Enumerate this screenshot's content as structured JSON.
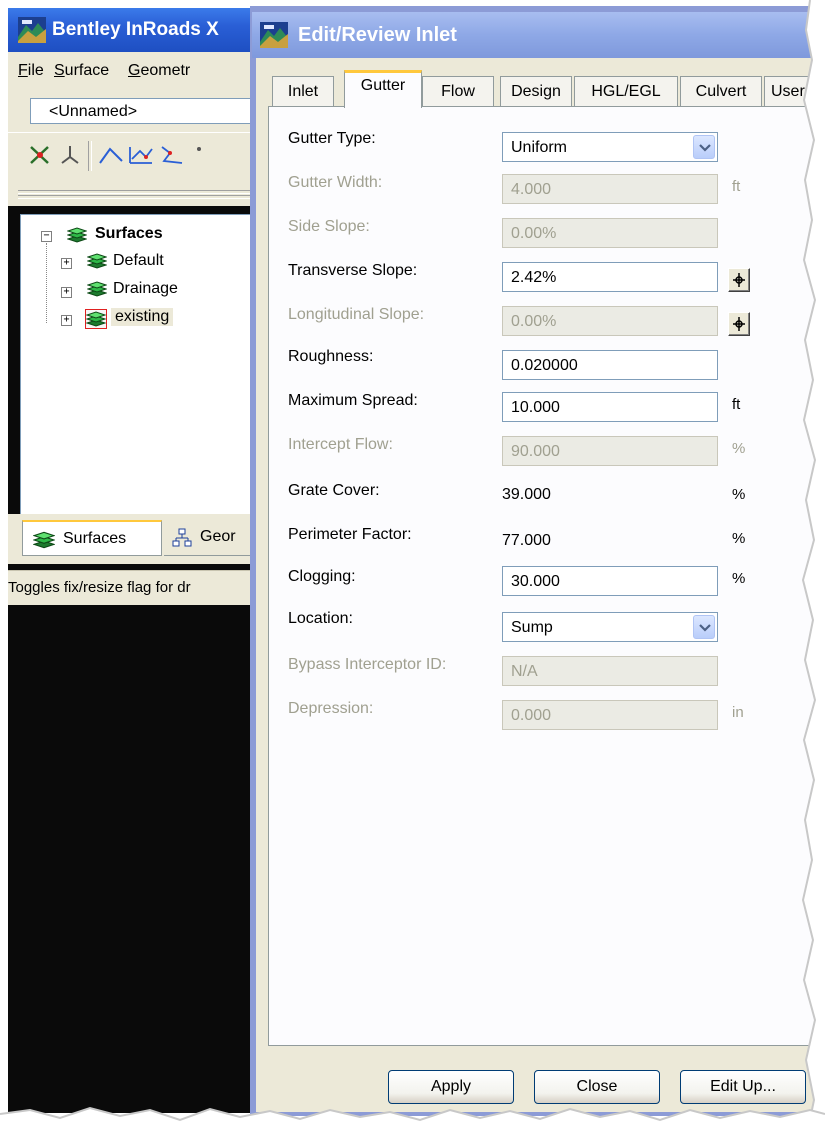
{
  "bg_window": {
    "title": "Bentley InRoads X",
    "menu": [
      {
        "label": "File",
        "accel": "F",
        "rest": "ile"
      },
      {
        "label": "Surface",
        "accel": "S",
        "rest": "urface"
      },
      {
        "label": "Geometr",
        "accel": "G",
        "rest": "eometr"
      }
    ],
    "combo_value": "<Unnamed>",
    "tree": {
      "root": "Surfaces",
      "items": [
        "Default",
        "Drainage",
        "existing"
      ]
    },
    "bottom_tabs": [
      "Surfaces",
      "Geor"
    ],
    "status_text": "Toggles fix/resize flag for dr"
  },
  "dialog": {
    "title": "Edit/Review Inlet",
    "tabs": [
      "Inlet",
      "Gutter",
      "Flow",
      "Design",
      "HGL/EGL",
      "Culvert",
      "User"
    ],
    "active_tab": "Gutter",
    "fields": {
      "gutter_type": {
        "label": "Gutter Type:",
        "value": "Uniform"
      },
      "gutter_width": {
        "label": "Gutter Width:",
        "value": "4.000",
        "unit": "ft"
      },
      "side_slope": {
        "label": "Side Slope:",
        "value": "0.00%"
      },
      "transverse_slope": {
        "label": "Transverse Slope:",
        "value": "2.42%"
      },
      "longitudinal_slope": {
        "label": "Longitudinal Slope:",
        "value": "0.00%"
      },
      "roughness": {
        "label": "Roughness:",
        "value": "0.020000"
      },
      "maximum_spread": {
        "label": "Maximum Spread:",
        "value": "10.000",
        "unit": "ft"
      },
      "intercept_flow": {
        "label": "Intercept Flow:",
        "value": "90.000",
        "unit": "%"
      },
      "grate_cover": {
        "label": "Grate Cover:",
        "value": "39.000",
        "unit": "%"
      },
      "perimeter_factor": {
        "label": "Perimeter Factor:",
        "value": "77.000",
        "unit": "%"
      },
      "clogging": {
        "label": "Clogging:",
        "value": "30.000",
        "unit": "%"
      },
      "location": {
        "label": "Location:",
        "value": "Sump"
      },
      "bypass_interceptor_id": {
        "label": "Bypass Interceptor ID:",
        "value": "N/A"
      },
      "depression": {
        "label": "Depression:",
        "value": "0.000",
        "unit": "in"
      }
    },
    "buttons": {
      "apply": "Apply",
      "close": "Close",
      "edit_up": "Edit Up..."
    }
  },
  "colors": {
    "bg_titlebar": "#2a5fd6",
    "dialog_titlebar_inactive": "#8ea8e6",
    "dialog_face": "#ece9d8",
    "active_tab_accent": "#ffc83c",
    "disabled_text": "#a0a090"
  }
}
